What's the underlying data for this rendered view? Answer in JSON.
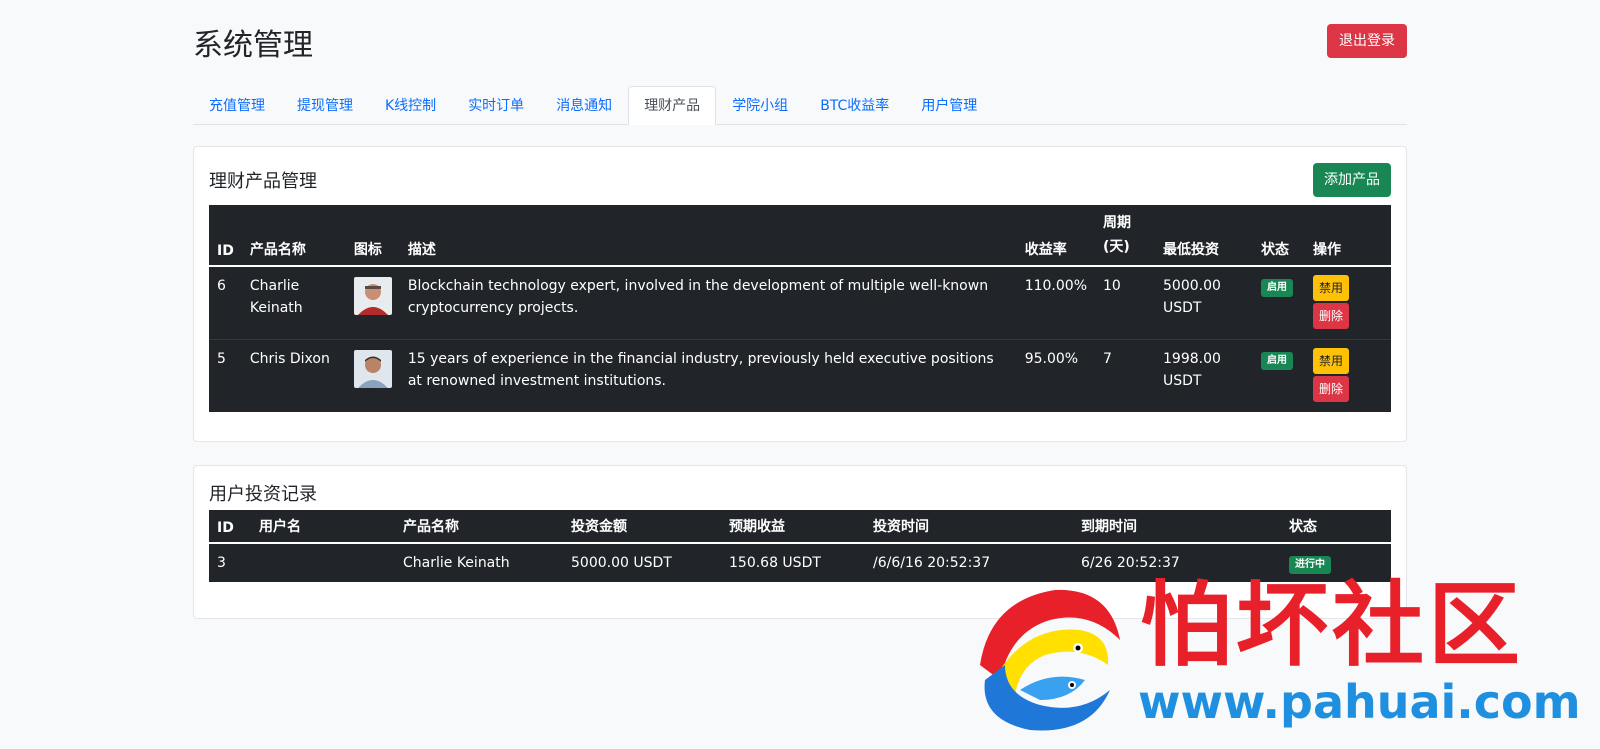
{
  "header": {
    "title": "系统管理",
    "logout_label": "退出登录"
  },
  "tabs": [
    {
      "label": "充值管理"
    },
    {
      "label": "提现管理"
    },
    {
      "label": "K线控制"
    },
    {
      "label": "实时订单"
    },
    {
      "label": "消息通知"
    },
    {
      "label": "理财产品",
      "active": true
    },
    {
      "label": "学院小组"
    },
    {
      "label": "BTC收益率"
    },
    {
      "label": "用户管理"
    }
  ],
  "products": {
    "title": "理财产品管理",
    "add_label": "添加产品",
    "columns": {
      "id": "ID",
      "name": "产品名称",
      "icon": "图标",
      "desc": "描述",
      "rate": "收益率",
      "period": "周期\n(天)",
      "min": "最低投资",
      "status": "状态",
      "ops": "操作"
    },
    "rows": [
      {
        "id": "6",
        "name": "Charlie Keinath",
        "desc": "Blockchain technology expert, involved in the development of multiple well-known cryptocurrency projects.",
        "rate": "110.00%",
        "period": "10",
        "min": "5000.00 USDT",
        "status": "启用",
        "disable_label": "禁用",
        "delete_label": "删除"
      },
      {
        "id": "5",
        "name": "Chris Dixon",
        "desc": "15 years of experience in the financial industry, previously held executive positions at renowned investment institutions.",
        "rate": "95.00%",
        "period": "7",
        "min": "1998.00 USDT",
        "status": "启用",
        "disable_label": "禁用",
        "delete_label": "删除"
      }
    ]
  },
  "records": {
    "title": "用户投资记录",
    "columns": {
      "id": "ID",
      "user": "用户名",
      "product": "产品名称",
      "amount": "投资金额",
      "expected": "预期收益",
      "invest_time": "投资时间",
      "expire_time": "到期时间",
      "status": "状态"
    },
    "rows": [
      {
        "id": "3",
        "user": "",
        "product": "Charlie Keinath",
        "amount": "5000.00 USDT",
        "expected": "150.68 USDT",
        "invest_time": "/6/6/16 20:52:37",
        "expire_time": "6/26 20:52:37",
        "status": "进行中"
      }
    ]
  },
  "watermark": {
    "text": "怕坏社区",
    "url": "www.pahuai.com"
  },
  "colors": {
    "danger": "#dc3545",
    "success": "#198754",
    "warning": "#ffc107",
    "primary": "#0d6efd",
    "table_dark": "#212529"
  }
}
